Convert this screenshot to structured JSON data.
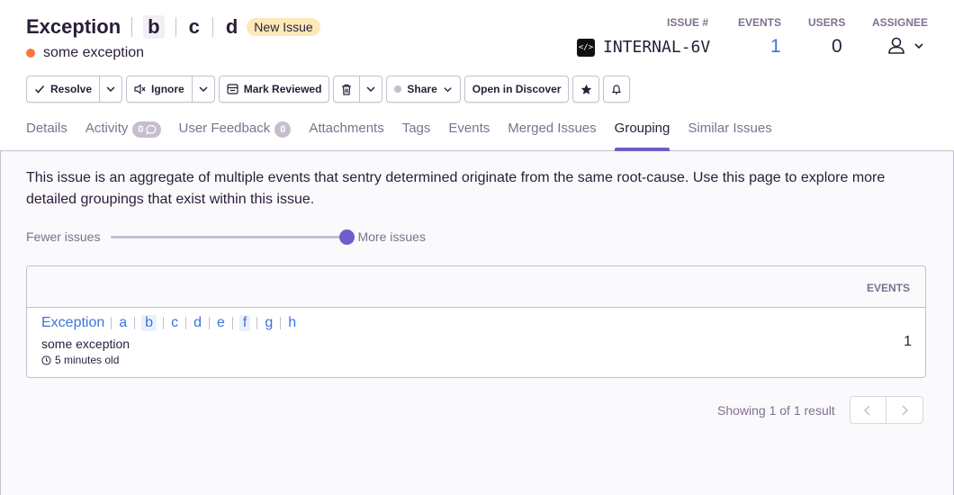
{
  "issue": {
    "title": "Exception",
    "crumbs": [
      "b",
      "c",
      "d"
    ],
    "status_badge": "New Issue",
    "message": "some exception",
    "level_color": "#f4773b"
  },
  "stats": {
    "issue_label": "ISSUE #",
    "issue_id": "INTERNAL-6V",
    "events_label": "EVENTS",
    "events_value": "1",
    "users_label": "USERS",
    "users_value": "0",
    "assignee_label": "ASSIGNEE"
  },
  "toolbar": {
    "resolve": "Resolve",
    "ignore": "Ignore",
    "mark_reviewed": "Mark Reviewed",
    "share": "Share",
    "open_in_discover": "Open in Discover"
  },
  "tabs": [
    {
      "label": "Details",
      "active": false
    },
    {
      "label": "Activity",
      "count": "0",
      "active": false
    },
    {
      "label": "User Feedback",
      "count": "0",
      "active": false
    },
    {
      "label": "Attachments",
      "active": false
    },
    {
      "label": "Tags",
      "active": false
    },
    {
      "label": "Events",
      "active": false
    },
    {
      "label": "Merged Issues",
      "active": false
    },
    {
      "label": "Grouping",
      "active": true
    },
    {
      "label": "Similar Issues",
      "active": false
    }
  ],
  "grouping": {
    "description": "This issue is an aggregate of multiple events that sentry determined originate from the same root-cause. Use this page to explore more detailed groupings that exist within this issue.",
    "slider_min_label": "Fewer issues",
    "slider_max_label": "More issues",
    "slider_level": 1.0
  },
  "table": {
    "events_header": "EVENTS",
    "rows": [
      {
        "title": "Exception",
        "crumbs": [
          "a",
          "b",
          "c",
          "d",
          "e",
          "f",
          "g",
          "h"
        ],
        "highlighted_crumbs": [
          "b",
          "f"
        ],
        "message": "some exception",
        "age": "5 minutes old",
        "events": "1"
      }
    ]
  },
  "pagination": {
    "caption": "Showing 1 of 1 result"
  },
  "colors": {
    "accent": "#6c5fc7",
    "link": "#3d74db",
    "muted": "#80708f",
    "border": "#c6becf",
    "badge_new": "#fde9b8"
  }
}
